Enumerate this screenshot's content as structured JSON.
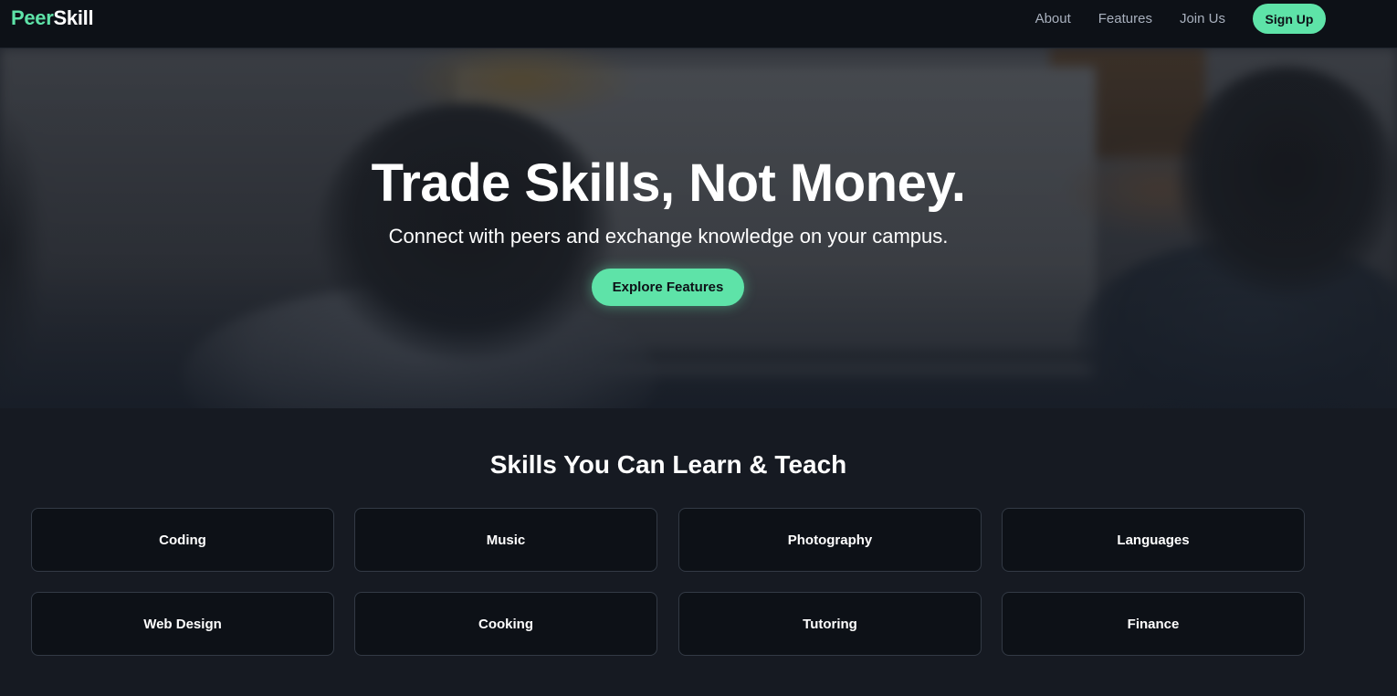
{
  "navbar": {
    "logo_accent": "Peer",
    "logo_rest": "Skill",
    "links": [
      {
        "label": "About"
      },
      {
        "label": "Features"
      },
      {
        "label": "Join Us"
      }
    ],
    "signup_label": "Sign Up"
  },
  "hero": {
    "title": "Trade Skills, Not Money.",
    "subtitle": "Connect with peers and exchange knowledge on your campus.",
    "cta_label": "Explore Features"
  },
  "skills": {
    "title": "Skills You Can Learn & Teach",
    "items": [
      {
        "label": "Coding"
      },
      {
        "label": "Music"
      },
      {
        "label": "Photography"
      },
      {
        "label": "Languages"
      },
      {
        "label": "Web Design"
      },
      {
        "label": "Cooking"
      },
      {
        "label": "Tutoring"
      },
      {
        "label": "Finance"
      }
    ]
  },
  "colors": {
    "accent": "#5ee3a8",
    "navbar_bg": "#0d1117",
    "page_bg": "#161a22",
    "card_bg": "#0d1117",
    "card_border": "#333a45",
    "nav_link": "#a8b0bd"
  }
}
